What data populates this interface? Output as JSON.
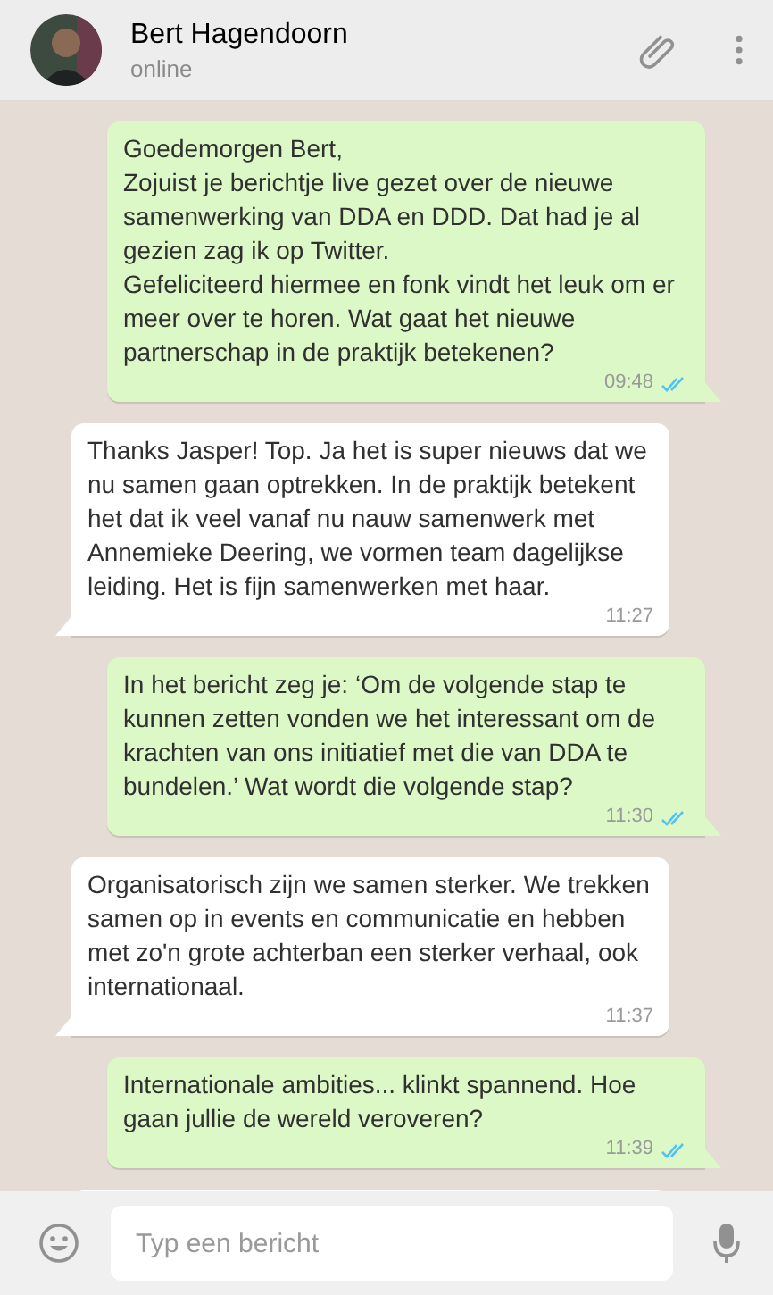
{
  "header": {
    "contact_name": "Bert Hagendoorn",
    "status": "online"
  },
  "messages": [
    {
      "kind": "outgoing",
      "text": "Goedemorgen Bert,\nZojuist je berichtje live gezet over de nieuwe samenwerking van DDA en DDD. Dat had je al gezien zag ik op Twitter.\nGefeliciteerd hiermee en fonk vindt het leuk om er meer over te horen. Wat gaat het nieuwe partnerschap in de praktijk betekenen?",
      "time": "09:48",
      "read": true
    },
    {
      "kind": "incoming",
      "text": "Thanks Jasper! Top. Ja het is super nieuws dat we nu samen gaan optrekken. In de praktijk betekent het dat ik veel vanaf nu nauw samenwerk met Annemieke Deering, we vormen team dagelijkse leiding. Het is fijn samenwerken met haar.",
      "time": "11:27"
    },
    {
      "kind": "outgoing",
      "text": "In het bericht zeg je: ‘Om de volgende stap te kunnen zetten vonden we het interessant om de krachten van ons initiatief met die van DDA te bundelen.’ Wat wordt die volgende stap?",
      "time": "11:30",
      "read": true
    },
    {
      "kind": "incoming",
      "text": "Organisatorisch zijn we samen sterker. We trekken samen op in events en communicatie en hebben met zo'n grote achterban een sterker verhaal, ook internationaal.",
      "time": "11:37"
    },
    {
      "kind": "outgoing",
      "text": "Internationale ambities... klinkt spannend. Hoe gaan jullie de wereld veroveren?",
      "time": "11:39",
      "read": true
    }
  ],
  "composer": {
    "placeholder": "Typ een bericht"
  }
}
